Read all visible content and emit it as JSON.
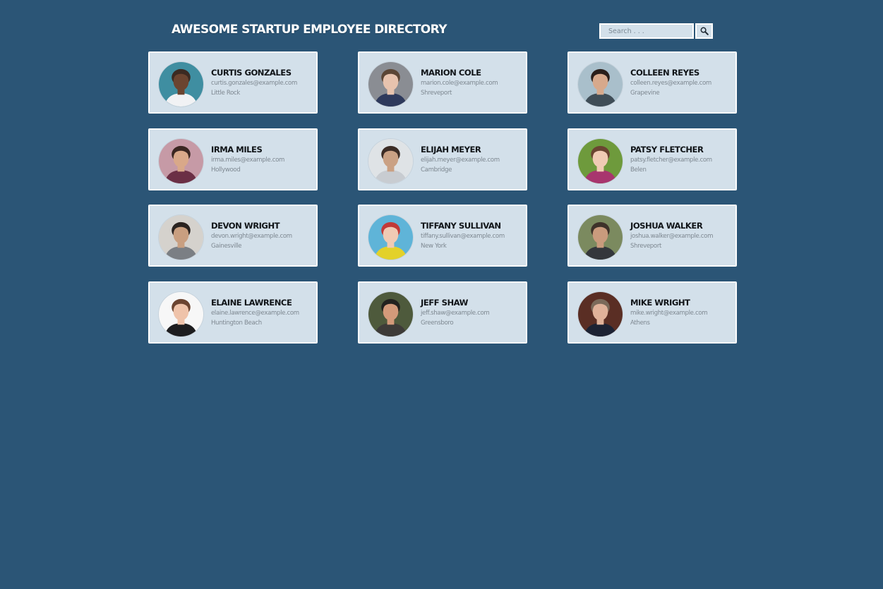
{
  "page": {
    "title": "AWESOME STARTUP EMPLOYEE DIRECTORY"
  },
  "search": {
    "placeholder": "Search . . .",
    "value": "",
    "button_icon": "search-icon"
  },
  "colors": {
    "background": "#2b5576",
    "card_background": "#d3e0ea",
    "card_border": "#ffffff",
    "title": "#ffffff",
    "name_text": "#101418",
    "secondary_text": "#7e8891"
  },
  "employees": [
    {
      "name": "CURTIS GONZALES",
      "email": "curtis.gonzales@example.com",
      "city": "Little Rock",
      "avatar": {
        "bg": "#3f8ea1",
        "skin": "#6b4430",
        "hair": "#3b2a22",
        "shirt": "#f1f2f4"
      }
    },
    {
      "name": "MARION COLE",
      "email": "marion.cole@example.com",
      "city": "Shreveport",
      "avatar": {
        "bg": "#8a8d93",
        "skin": "#e7c3ae",
        "hair": "#5b4636",
        "shirt": "#2e3a5c"
      }
    },
    {
      "name": "COLLEEN REYES",
      "email": "colleen.reyes@example.com",
      "city": "Grapevine",
      "avatar": {
        "bg": "#a9bfcb",
        "skin": "#d7a98c",
        "hair": "#2a1f1b",
        "shirt": "#3f4d57"
      }
    },
    {
      "name": "IRMA MILES",
      "email": "irma.miles@example.com",
      "city": "Hollywood",
      "avatar": {
        "bg": "#c69aa6",
        "skin": "#d9a889",
        "hair": "#3a2621",
        "shirt": "#6b2f45"
      }
    },
    {
      "name": "ELIJAH MEYER",
      "email": "elijah.meyer@example.com",
      "city": "Cambridge",
      "avatar": {
        "bg": "#dfe3e6",
        "skin": "#caa184",
        "hair": "#3c2c25",
        "shirt": "#c8ccd1"
      }
    },
    {
      "name": "PATSY FLETCHER",
      "email": "patsy.fletcher@example.com",
      "city": "Belen",
      "avatar": {
        "bg": "#6e9a3c",
        "skin": "#f0cbb4",
        "hair": "#6b4431",
        "shirt": "#a8356e"
      }
    },
    {
      "name": "DEVON WRIGHT",
      "email": "devon.wright@example.com",
      "city": "Gainesville",
      "avatar": {
        "bg": "#d5d2cd",
        "skin": "#c99f80",
        "hair": "#2a2320",
        "shirt": "#7b7f84"
      }
    },
    {
      "name": "TIFFANY SULLIVAN",
      "email": "tiffany.sullivan@example.com",
      "city": "New York",
      "avatar": {
        "bg": "#5fb4d8",
        "skin": "#f0cab4",
        "hair": "#c23a38",
        "shirt": "#e3d12a"
      }
    },
    {
      "name": "JOSHUA WALKER",
      "email": "joshua.walker@example.com",
      "city": "Shreveport",
      "avatar": {
        "bg": "#7b8a5f",
        "skin": "#c99b7d",
        "hair": "#3e322a",
        "shirt": "#34373c"
      }
    },
    {
      "name": "ELAINE LAWRENCE",
      "email": "elaine.lawrence@example.com",
      "city": "Huntington Beach",
      "avatar": {
        "bg": "#f7f7f7",
        "skin": "#efc3aa",
        "hair": "#6b4431",
        "shirt": "#1d1d1f"
      }
    },
    {
      "name": "JEFF SHAW",
      "email": "jeff.shaw@example.com",
      "city": "Greensboro",
      "avatar": {
        "bg": "#4e5a3c",
        "skin": "#d39a7a",
        "hair": "#23221f",
        "shirt": "#3d3b38"
      }
    },
    {
      "name": "MIKE WRIGHT",
      "email": "mike.wright@example.com",
      "city": "Athens",
      "avatar": {
        "bg": "#5a2e24",
        "skin": "#e0b29a",
        "hair": "#7b6a5a",
        "shirt": "#1c2233"
      }
    }
  ]
}
